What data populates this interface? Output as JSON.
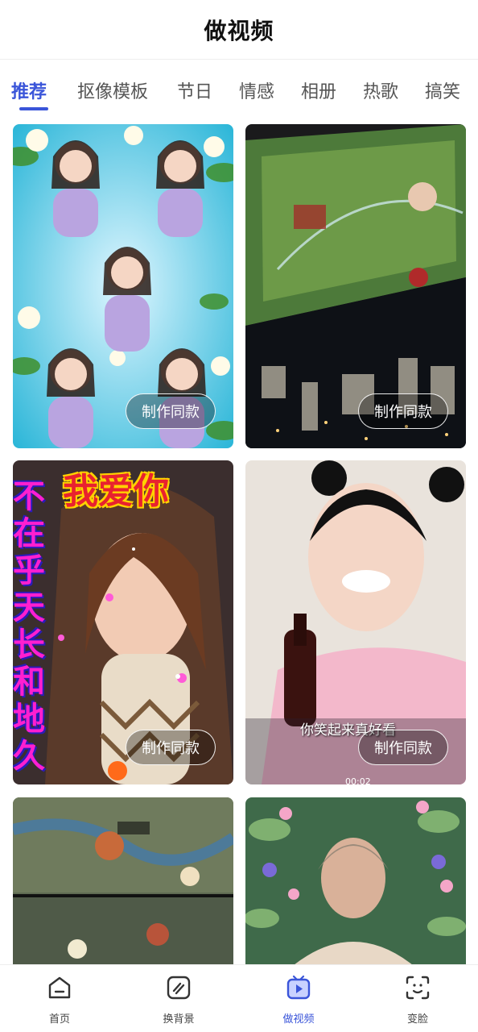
{
  "header": {
    "title": "做视频"
  },
  "tabs": [
    {
      "label": "推荐",
      "active": true
    },
    {
      "label": "抠像模板",
      "active": false
    },
    {
      "label": "节日",
      "active": false
    },
    {
      "label": "情感",
      "active": false
    },
    {
      "label": "相册",
      "active": false
    },
    {
      "label": "热歌",
      "active": false
    },
    {
      "label": "搞笑",
      "active": false
    }
  ],
  "cards": [
    {
      "button": "制作同款",
      "thumbnail": "portrait-collage-flowers"
    },
    {
      "button": "制作同款",
      "thumbnail": "game-screen-city"
    },
    {
      "button": "制作同款",
      "thumbnail": "woman-sparkles",
      "overlay_top": "我爱你",
      "overlay_side": "不在乎天长和地久"
    },
    {
      "button": "制作同款",
      "thumbnail": "girl-cola",
      "overlay_sub": "你笑起来真好看",
      "overlay_time": "00:02"
    },
    {
      "thumbnail": "game-screenshots"
    },
    {
      "thumbnail": "elder-flowers"
    }
  ],
  "bottom_nav": [
    {
      "label": "首页",
      "icon": "home-icon",
      "active": false
    },
    {
      "label": "换背景",
      "icon": "background-swap-icon",
      "active": false
    },
    {
      "label": "做视频",
      "icon": "video-play-icon",
      "active": true
    },
    {
      "label": "变脸",
      "icon": "face-scan-icon",
      "active": false
    }
  ],
  "colors": {
    "accent": "#3a55d9",
    "button_border": "#ffffff"
  }
}
